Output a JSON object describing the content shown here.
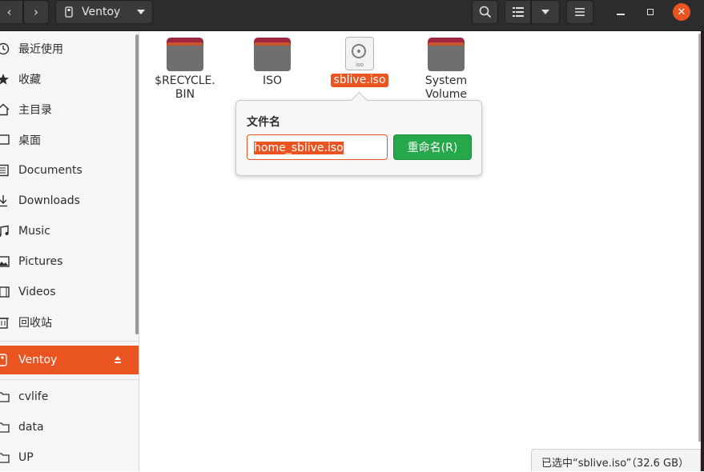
{
  "header": {
    "location": "Ventoy"
  },
  "sidebar": {
    "items": [
      {
        "label": "最近使用",
        "icon": "clock-icon"
      },
      {
        "label": "收藏",
        "icon": "star-icon"
      },
      {
        "label": "主目录",
        "icon": "home-icon"
      },
      {
        "label": "桌面",
        "icon": "desktop-icon"
      },
      {
        "label": "Documents",
        "icon": "document-icon"
      },
      {
        "label": "Downloads",
        "icon": "download-icon"
      },
      {
        "label": "Music",
        "icon": "music-icon"
      },
      {
        "label": "Pictures",
        "icon": "picture-icon"
      },
      {
        "label": "Videos",
        "icon": "video-icon"
      },
      {
        "label": "回收站",
        "icon": "trash-icon"
      }
    ],
    "device": {
      "label": "Ventoy",
      "icon": "usb-drive-icon"
    },
    "bookmarks": [
      {
        "label": "cvlife",
        "icon": "folder-icon"
      },
      {
        "label": "data",
        "icon": "folder-icon"
      },
      {
        "label": "UP",
        "icon": "folder-icon"
      }
    ]
  },
  "files": [
    {
      "name_line1": "$RECYCLE.",
      "name_line2": "BIN",
      "type": "folder"
    },
    {
      "name_line1": "ISO",
      "name_line2": "",
      "type": "folder"
    },
    {
      "name_line1": "sblive.iso",
      "name_line2": "",
      "type": "iso",
      "icon_label": "iso",
      "selected": true
    },
    {
      "name_line1": "System",
      "name_line2": "Volume",
      "type": "folder"
    }
  ],
  "rename": {
    "title": "文件名",
    "value": "home_sblive.iso",
    "button": "重命名(R)"
  },
  "status": {
    "text": "已选中“sblive.iso”（32.6 GB）"
  },
  "colors": {
    "accent": "#e95420",
    "confirm": "#26a74a",
    "header": "#2c2c2c"
  }
}
